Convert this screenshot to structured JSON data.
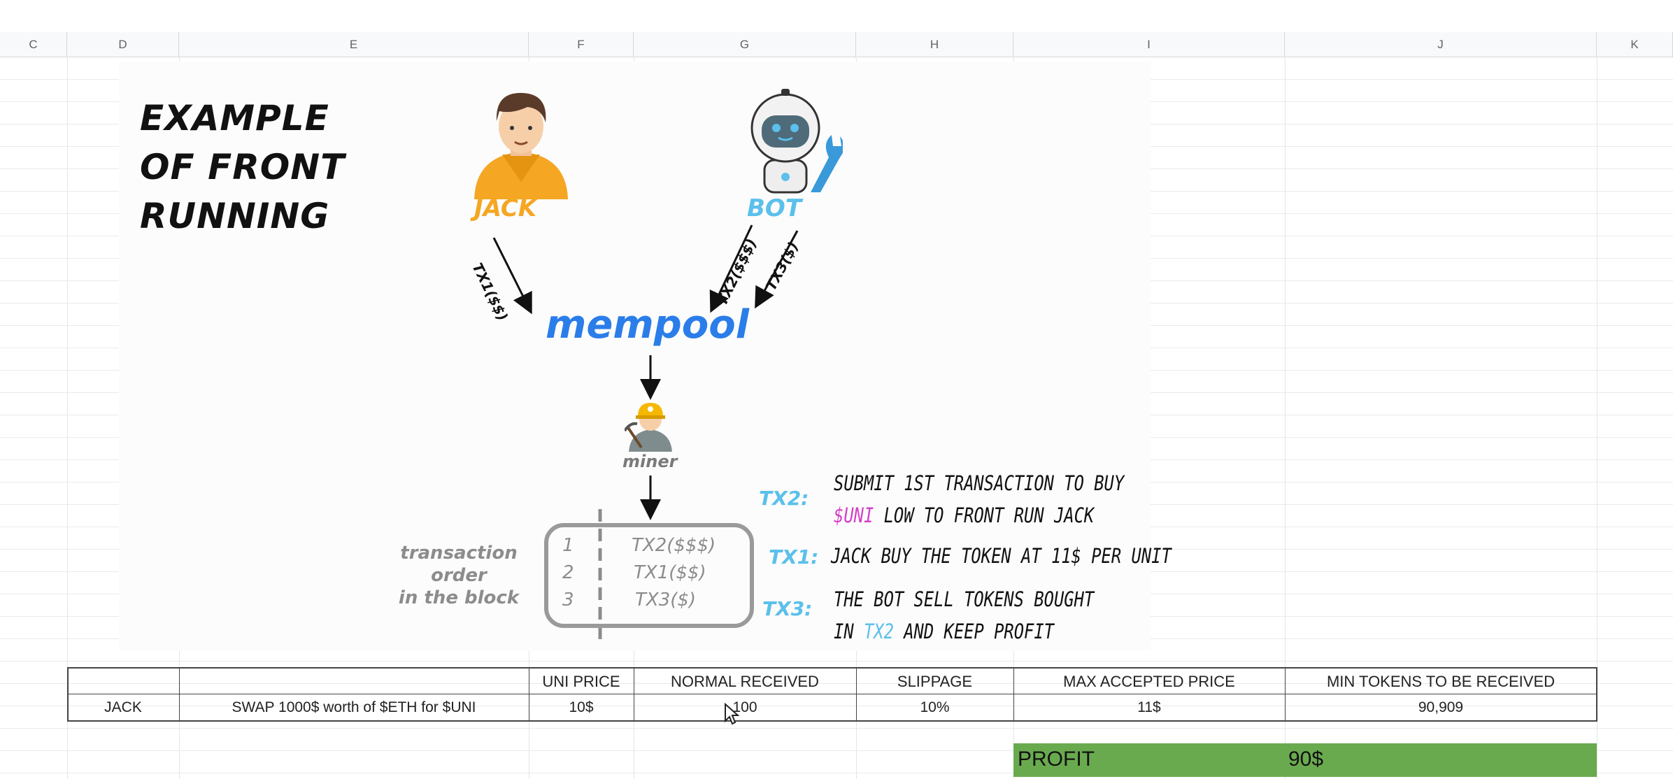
{
  "columns": [
    "C",
    "D",
    "E",
    "F",
    "G",
    "H",
    "I",
    "J",
    "K"
  ],
  "diagram": {
    "title_lines": [
      "EXAMPLE",
      "OF FRONT",
      "RUNNING"
    ],
    "jack_label": "JACK",
    "bot_label": "BOT",
    "tx_arrows": [
      "TX1($$)",
      "TX2($$$)",
      "TX3($)"
    ],
    "mempool_label": "mempool",
    "miner_label": "miner",
    "order_label_lines": [
      "transaction",
      "order",
      "in the block"
    ],
    "block_rows": [
      {
        "num": "1",
        "tx": "TX2($$$)"
      },
      {
        "num": "2",
        "tx": "TX1($$)"
      },
      {
        "num": "3",
        "tx": "TX3($)"
      }
    ],
    "explanations": {
      "tx2_key": "TX2:",
      "tx2_line1": "SUBMIT 1ST TRANSACTION TO BUY",
      "tx2_line2_highlight": "$UNI",
      "tx2_line2_rest": " LOW TO FRONT RUN JACK",
      "tx1_key": "TX1:",
      "tx1_line": "JACK BUY THE TOKEN AT 11$ PER UNIT",
      "tx3_key": "TX3:",
      "tx3_line1": "THE BOT SELL TOKENS BOUGHT",
      "tx3_line2_pre": "IN ",
      "tx3_line2_highlight": "TX2",
      "tx3_line2_rest": " AND KEEP PROFIT"
    },
    "colors": {
      "jack": "#f5a623",
      "bot": "#5bc0eb",
      "mempool": "#2b7de9",
      "highlight_pink": "#d43fc7"
    }
  },
  "table": {
    "headers": [
      "UNI PRICE",
      "NORMAL RECEIVED",
      "SLIPPAGE",
      "MAX ACCEPTED PRICE",
      "MIN TOKENS TO BE RECEIVED"
    ],
    "row": {
      "name": "JACK",
      "action": "SWAP 1000$ worth of $ETH for $UNI",
      "uni_price": "10$",
      "normal_received": "100",
      "slippage": "10%",
      "max_price": "11$",
      "min_tokens": "90,909"
    }
  },
  "profit": {
    "label": "PROFIT",
    "value": "90$",
    "color": "#6aaa4f"
  }
}
